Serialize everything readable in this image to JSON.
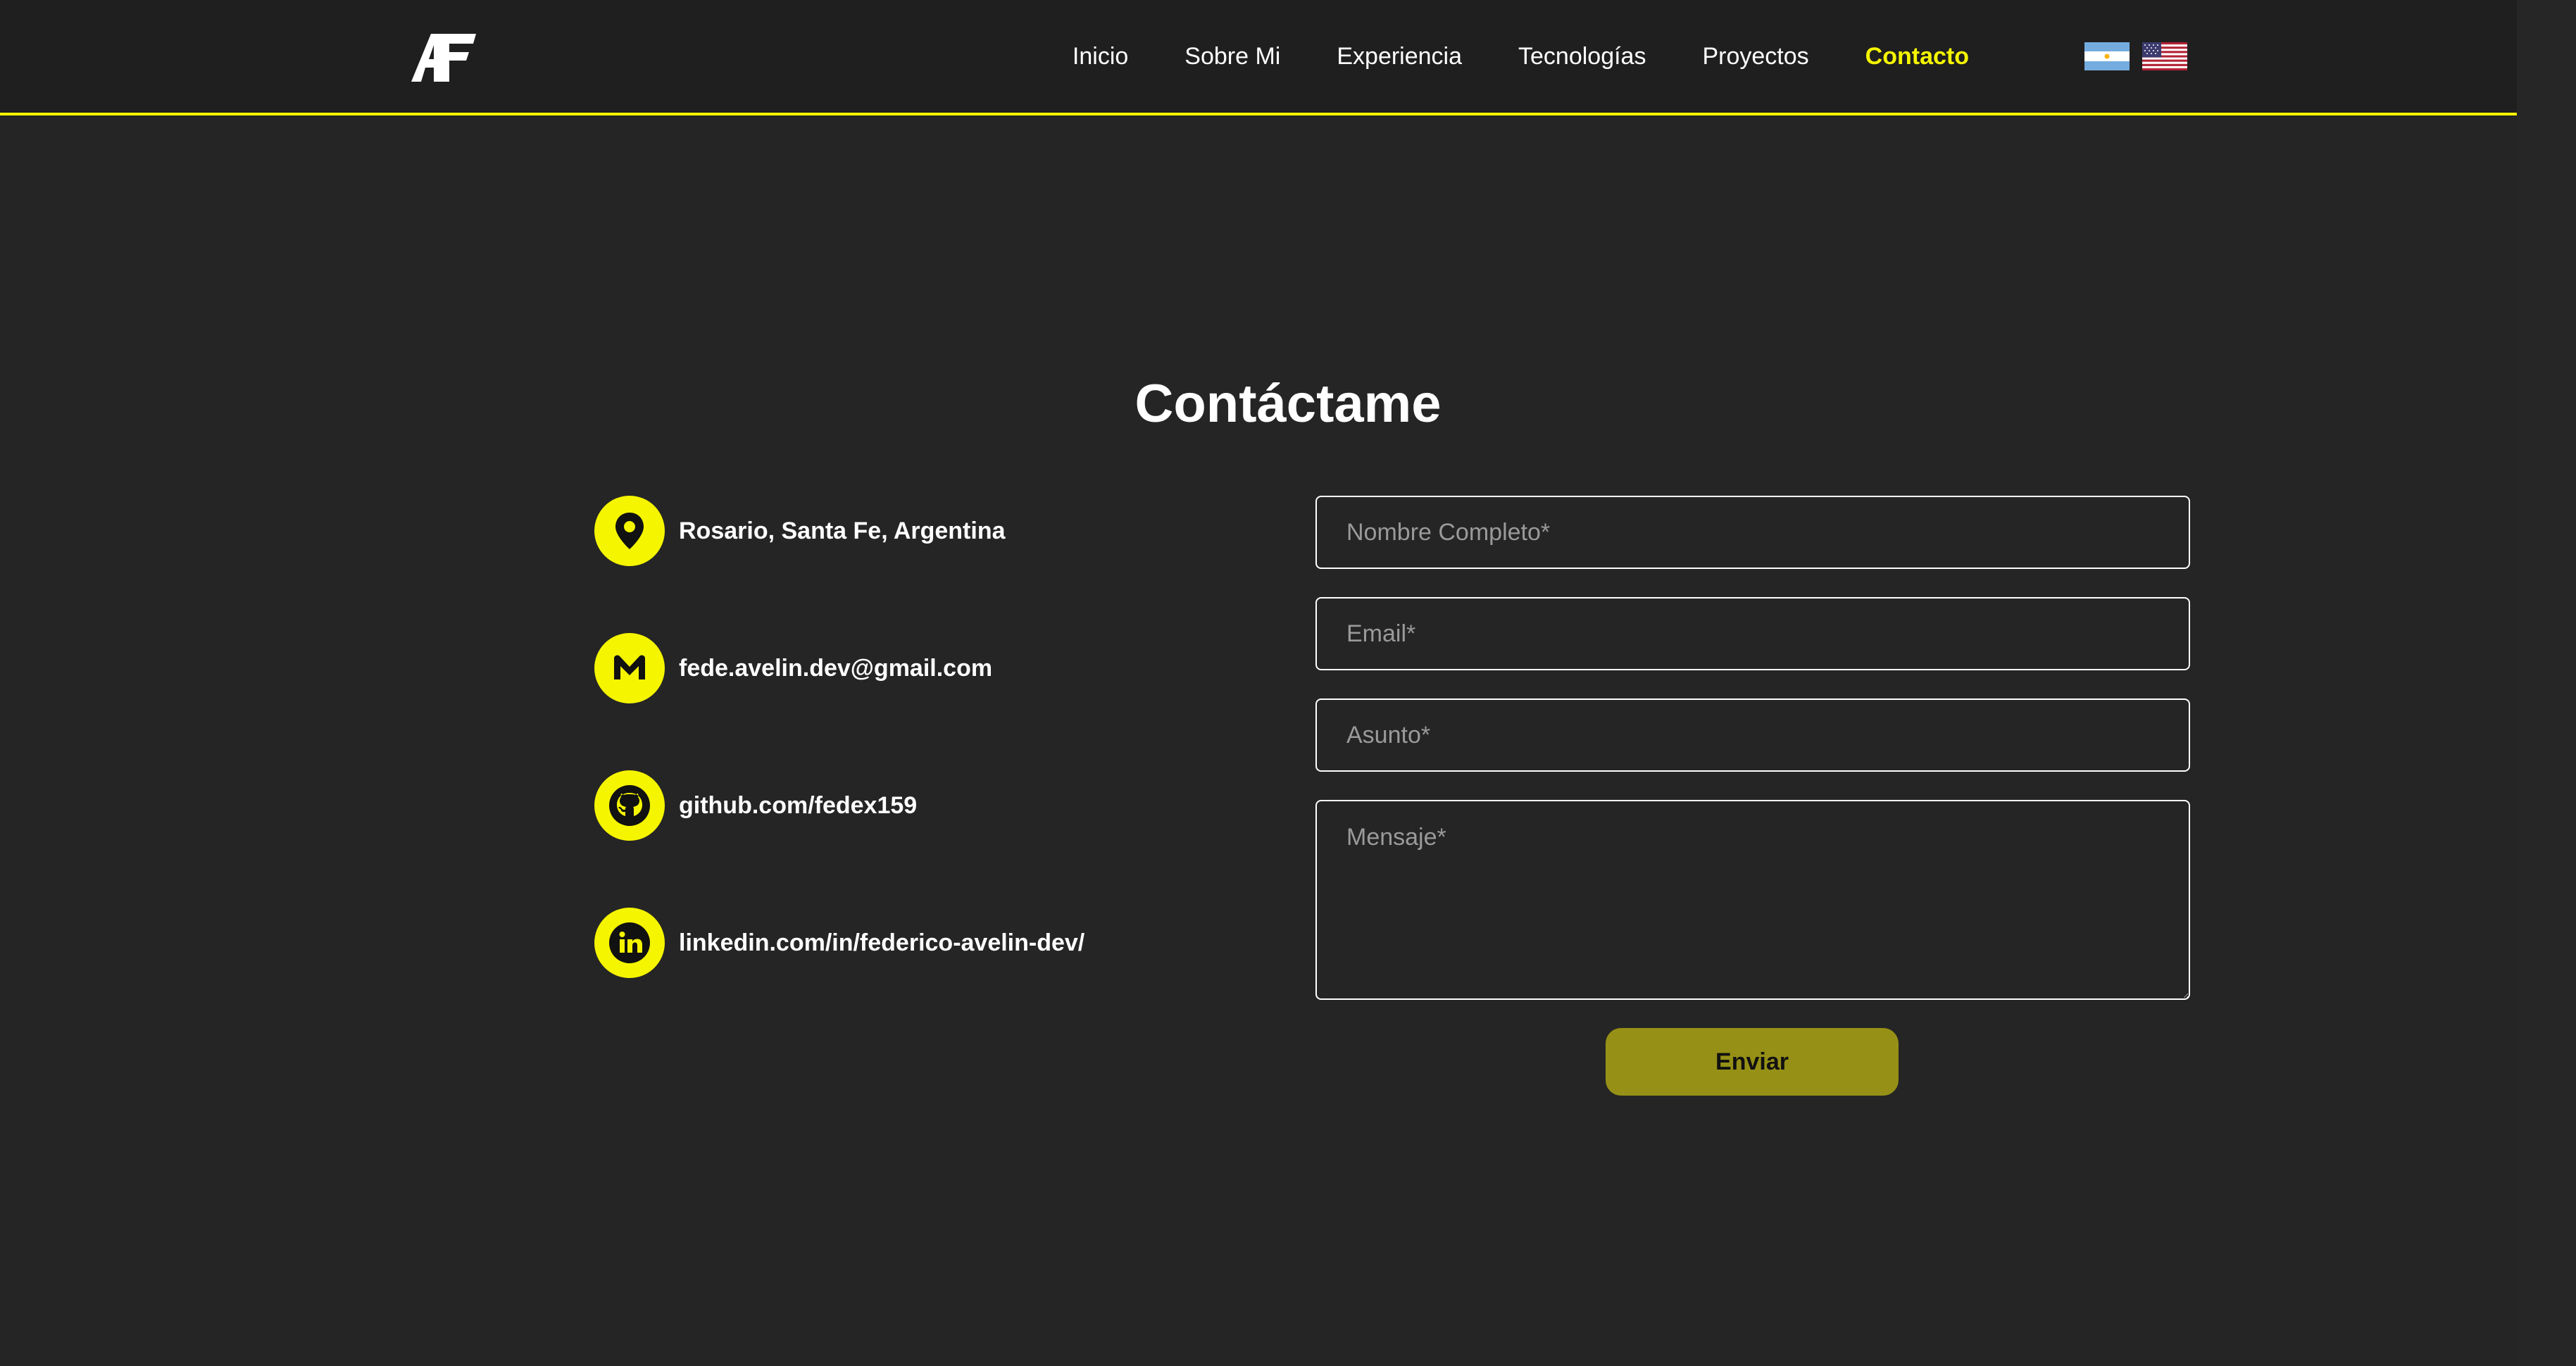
{
  "brand": {
    "logo_text": "AF"
  },
  "nav": {
    "links": [
      {
        "label": "Inicio"
      },
      {
        "label": "Sobre Mi"
      },
      {
        "label": "Experiencia"
      },
      {
        "label": "Tecnologías"
      },
      {
        "label": "Proyectos"
      },
      {
        "label": "Contacto",
        "active": true
      }
    ],
    "languages": [
      {
        "icon": "argentina-flag-icon"
      },
      {
        "icon": "usa-flag-icon"
      }
    ]
  },
  "contact": {
    "title": "Contáctame",
    "items": [
      {
        "icon": "location-pin-icon",
        "text": "Rosario, Santa Fe, Argentina"
      },
      {
        "icon": "gmail-icon",
        "text": "fede.avelin.dev@gmail.com"
      },
      {
        "icon": "github-icon",
        "text": "github.com/fedex159"
      },
      {
        "icon": "linkedin-icon",
        "text": "linkedin.com/in/federico-avelin-dev/"
      }
    ],
    "form": {
      "name_placeholder": "Nombre Completo*",
      "email_placeholder": "Email*",
      "subject_placeholder": "Asunto*",
      "message_placeholder": "Mensaje*",
      "submit_label": "Enviar"
    }
  },
  "colors": {
    "background": "#252525",
    "navbar": "#1f1f1f",
    "accent": "#f5f500",
    "button": "#969116"
  }
}
